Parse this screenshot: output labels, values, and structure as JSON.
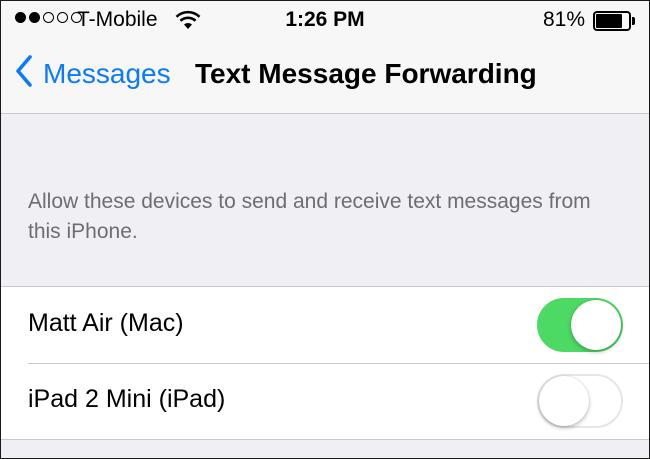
{
  "status_bar": {
    "carrier": "T-Mobile",
    "signal_strength_filled": 2,
    "signal_strength_total": 5,
    "time": "1:26 PM",
    "battery_percent": "81%",
    "battery_level": 0.81
  },
  "nav": {
    "back_label": "Messages",
    "title": "Text Message Forwarding"
  },
  "section": {
    "footer": "Allow these devices to send and receive text messages from this iPhone."
  },
  "devices": [
    {
      "label": "Matt Air (Mac)",
      "enabled": true
    },
    {
      "label": "iPad 2 Mini (iPad)",
      "enabled": false
    }
  ],
  "colors": {
    "accent": "#0a7aff",
    "toggle_on": "#4cd964",
    "background": "#efeff4"
  },
  "icons": {
    "back": "chevron-left-icon",
    "wifi": "wifi-icon",
    "battery": "battery-icon"
  }
}
